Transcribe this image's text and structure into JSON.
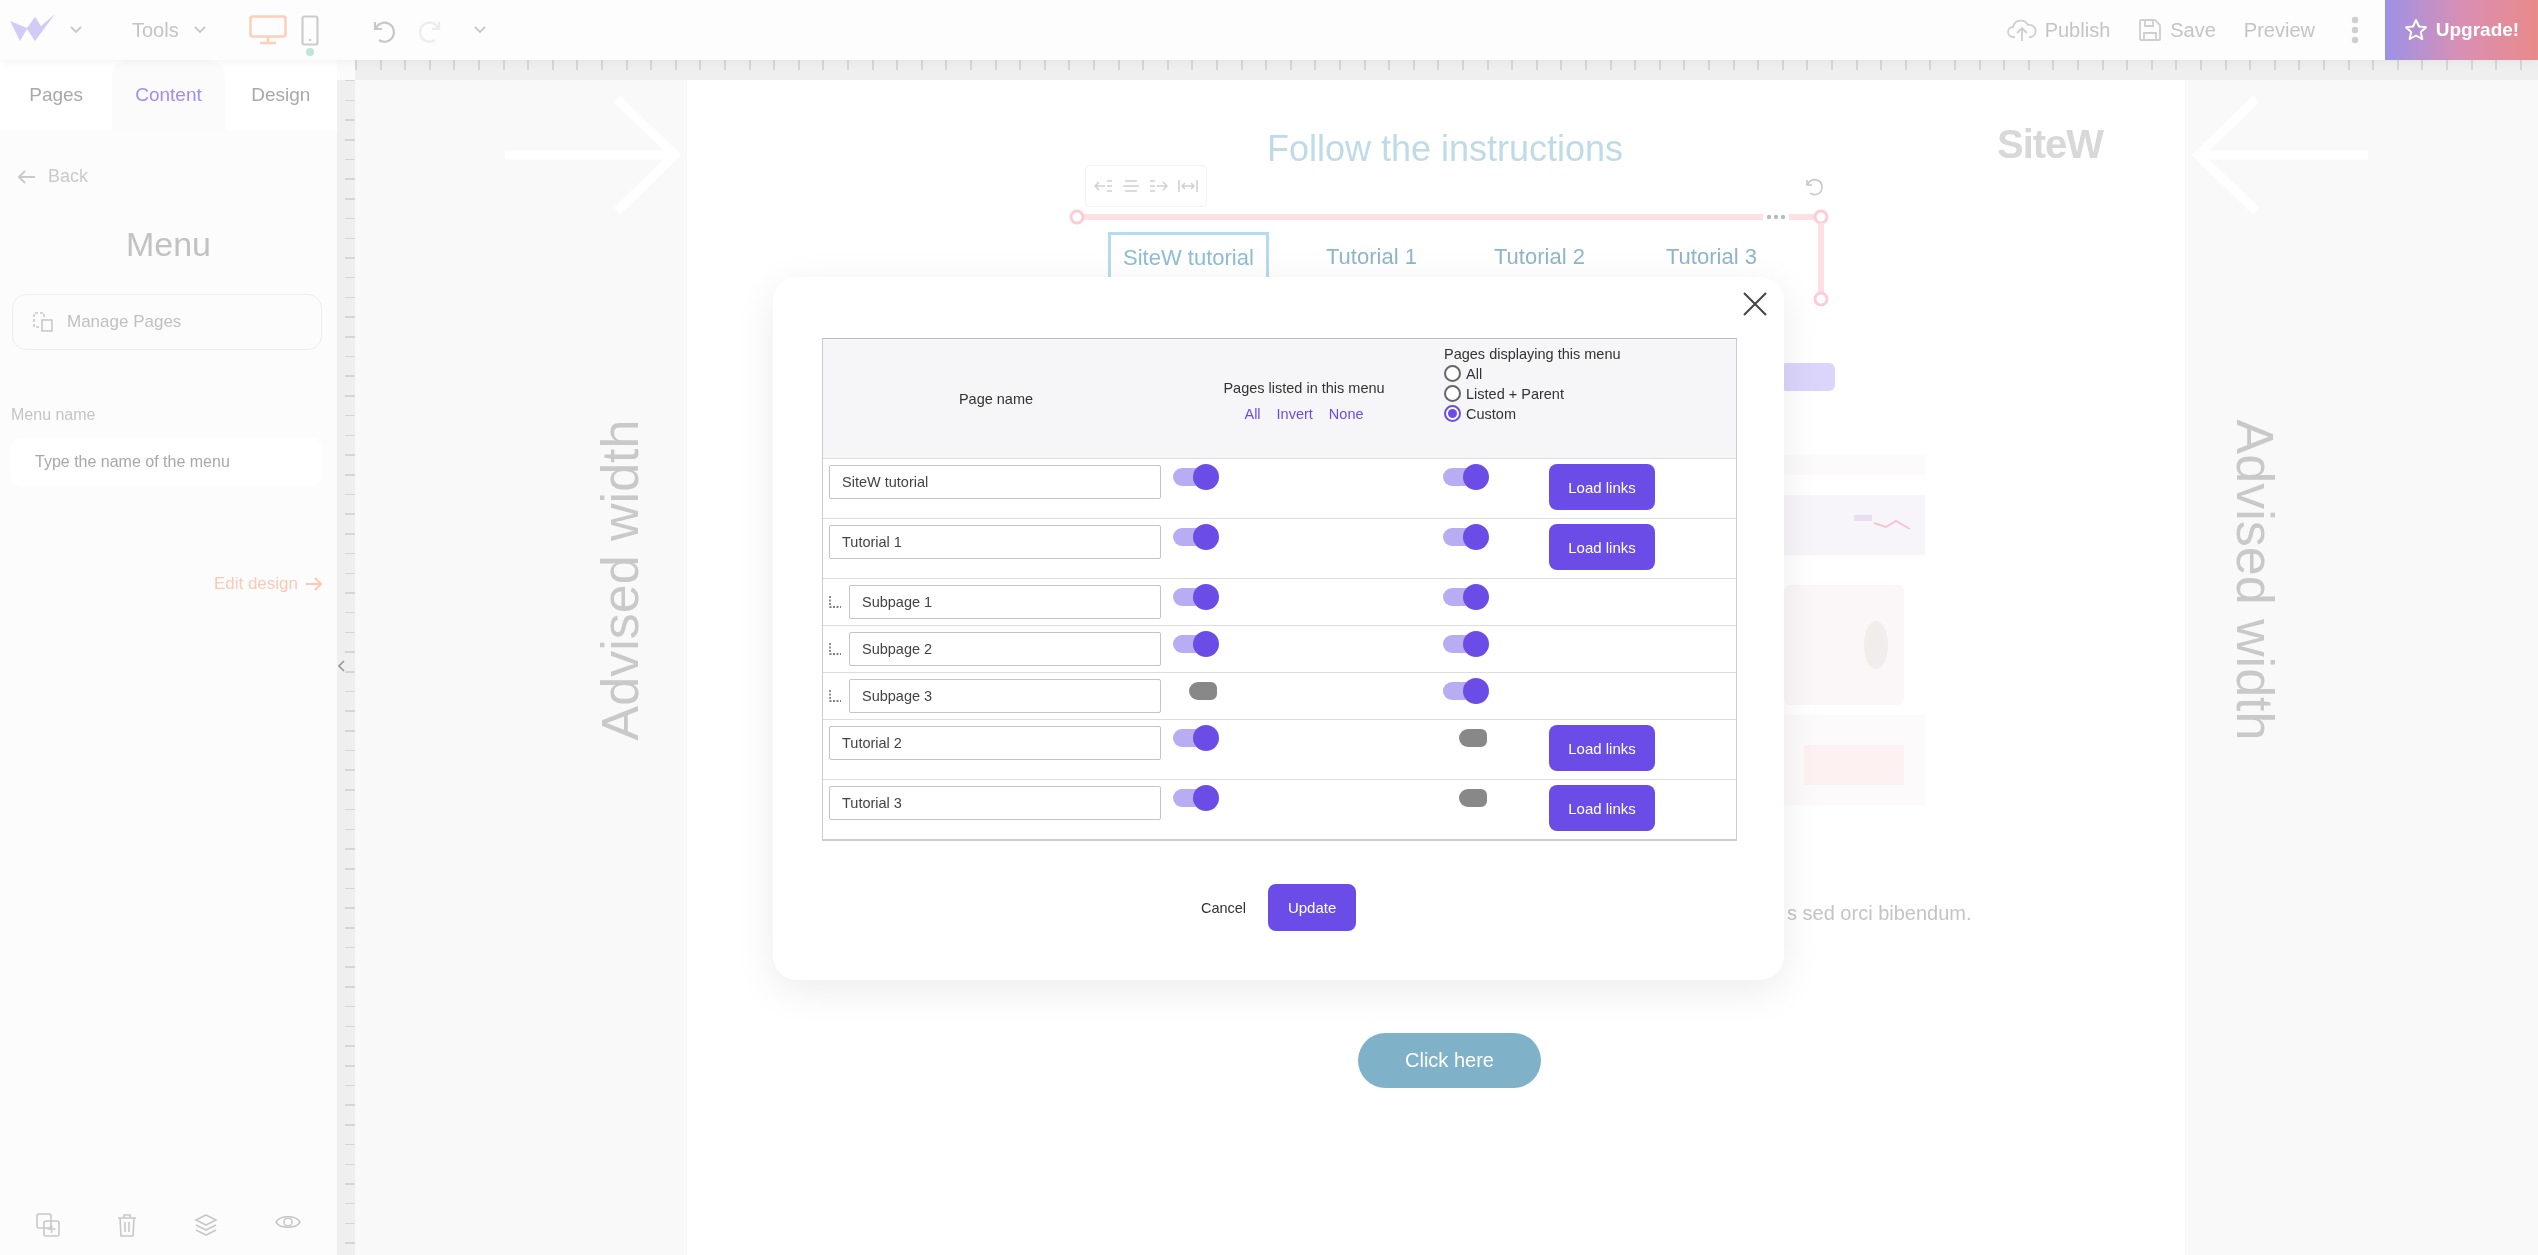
{
  "topbar": {
    "tools_label": "Tools",
    "devices": [
      {
        "kind": "desktop",
        "selected": true
      },
      {
        "kind": "mobile",
        "selected": false
      }
    ],
    "history": [
      {
        "kind": "undo",
        "disabled": false
      },
      {
        "kind": "redo",
        "disabled": true
      }
    ],
    "actions": [
      {
        "kind": "publish",
        "label": "Publish"
      },
      {
        "kind": "save",
        "label": "Save"
      },
      {
        "kind": "preview",
        "label": "Preview"
      }
    ],
    "upgrade_label": "Upgrade!"
  },
  "sidebar": {
    "tabs": [
      {
        "label": "Pages",
        "selected": false
      },
      {
        "label": "Content",
        "selected": true
      },
      {
        "label": "Design",
        "selected": false
      }
    ],
    "back_label": "Back",
    "title": "Menu",
    "manage_pages_label": "Manage Pages",
    "menu_name": {
      "label": "Menu name",
      "placeholder": "Type the name of the menu"
    },
    "edit_design_label": "Edit design"
  },
  "canvas": {
    "side_labels": [
      "Advised width",
      "Advised width"
    ],
    "heading": "Follow the instructions",
    "logo": "SiteW",
    "menu_items": [
      {
        "label": "SiteW tutorial",
        "selected": true
      },
      {
        "label": "Tutorial 1",
        "selected": false
      },
      {
        "label": "Tutorial 2",
        "selected": false
      },
      {
        "label": "Tutorial 3",
        "selected": false
      }
    ],
    "body_text": "s sed orci bibendum.",
    "cta_label": "Click here"
  },
  "dialog": {
    "columns": {
      "page_name": "Page name",
      "listed": "Pages listed in this menu",
      "displaying": "Pages displaying this menu"
    },
    "listed_links": [
      "All",
      "Invert",
      "None"
    ],
    "display_options": [
      {
        "label": "All",
        "selected": false
      },
      {
        "label": "Listed + Parent",
        "selected": false
      },
      {
        "label": "Custom",
        "selected": true
      }
    ],
    "rows": [
      {
        "name": "SiteW tutorial",
        "listed": true,
        "displayed": true,
        "action_label": "Load links"
      },
      {
        "name": "Tutorial 1",
        "listed": true,
        "displayed": true,
        "action_label": "Load links",
        "children": [
          {
            "name": "Subpage 1",
            "listed": true,
            "displayed": true
          },
          {
            "name": "Subpage 2",
            "listed": true,
            "displayed": true
          },
          {
            "name": "Subpage 3",
            "listed": false,
            "displayed": true
          }
        ]
      },
      {
        "name": "Tutorial 2",
        "listed": true,
        "displayed": false,
        "action_label": "Load links"
      },
      {
        "name": "Tutorial 3",
        "listed": true,
        "displayed": false,
        "action_label": "Load links"
      }
    ],
    "cancel_label": "Cancel",
    "update_label": "Update"
  }
}
